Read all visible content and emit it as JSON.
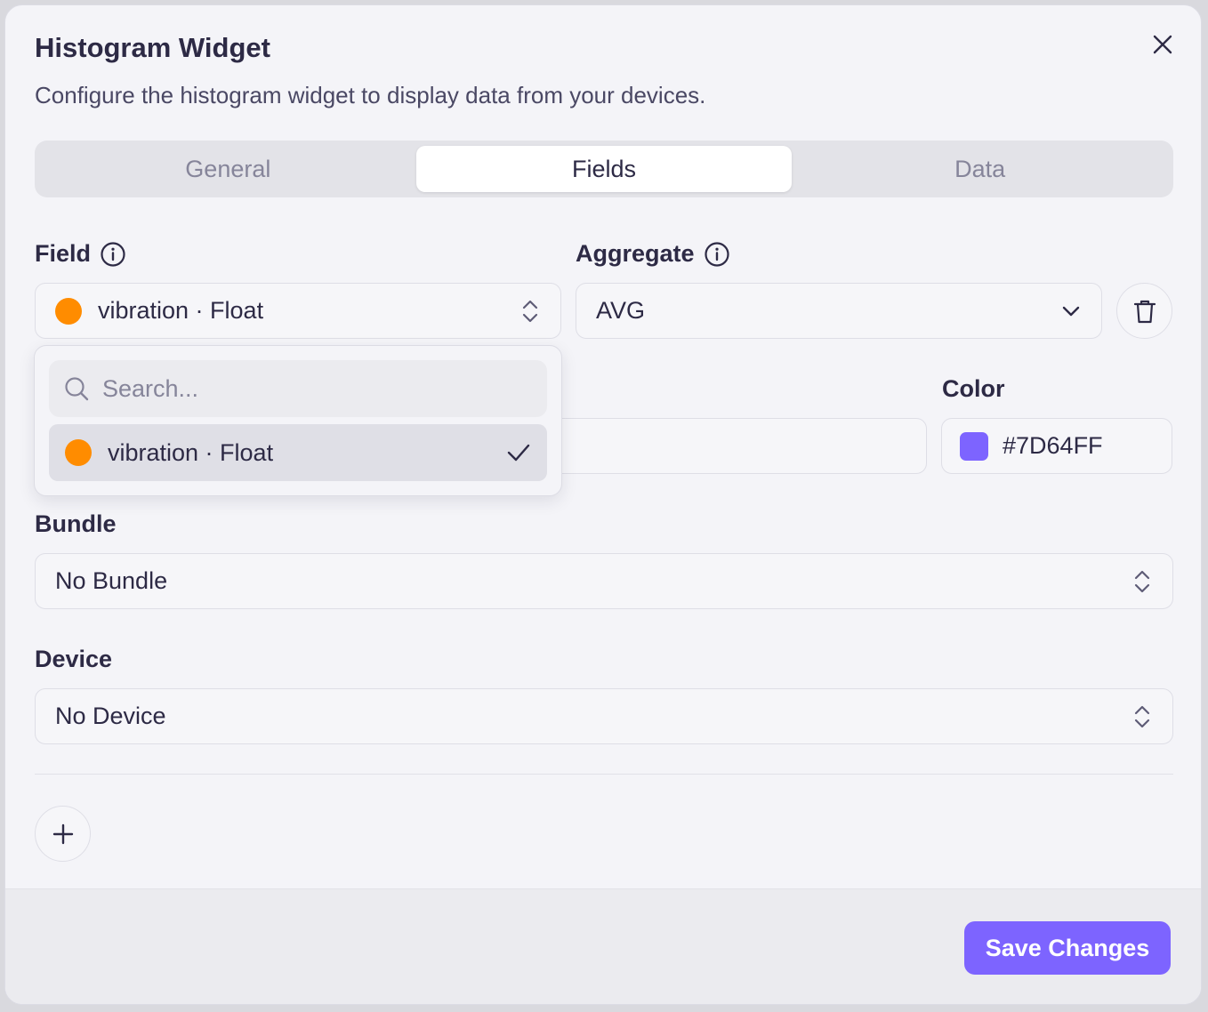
{
  "dialog": {
    "title": "Histogram Widget",
    "subtitle": "Configure the histogram widget to display data from your devices."
  },
  "tabs": [
    {
      "label": "General",
      "active": false
    },
    {
      "label": "Fields",
      "active": true
    },
    {
      "label": "Data",
      "active": false
    }
  ],
  "field": {
    "label": "Field",
    "value": "vibration · Float",
    "dot_color": "#FF8C00"
  },
  "aggregate": {
    "label": "Aggregate",
    "value": "AVG"
  },
  "color": {
    "label": "Color",
    "value": "#7D64FF"
  },
  "dropdown": {
    "search_placeholder": "Search...",
    "options": [
      {
        "label": "vibration · Float",
        "selected": true
      }
    ]
  },
  "bundle": {
    "label": "Bundle",
    "value": "No Bundle"
  },
  "device": {
    "label": "Device",
    "value": "No Device"
  },
  "footer": {
    "save_label": "Save Changes"
  },
  "colors": {
    "accent": "#7D64FF",
    "field_dot": "#FF8C00"
  }
}
